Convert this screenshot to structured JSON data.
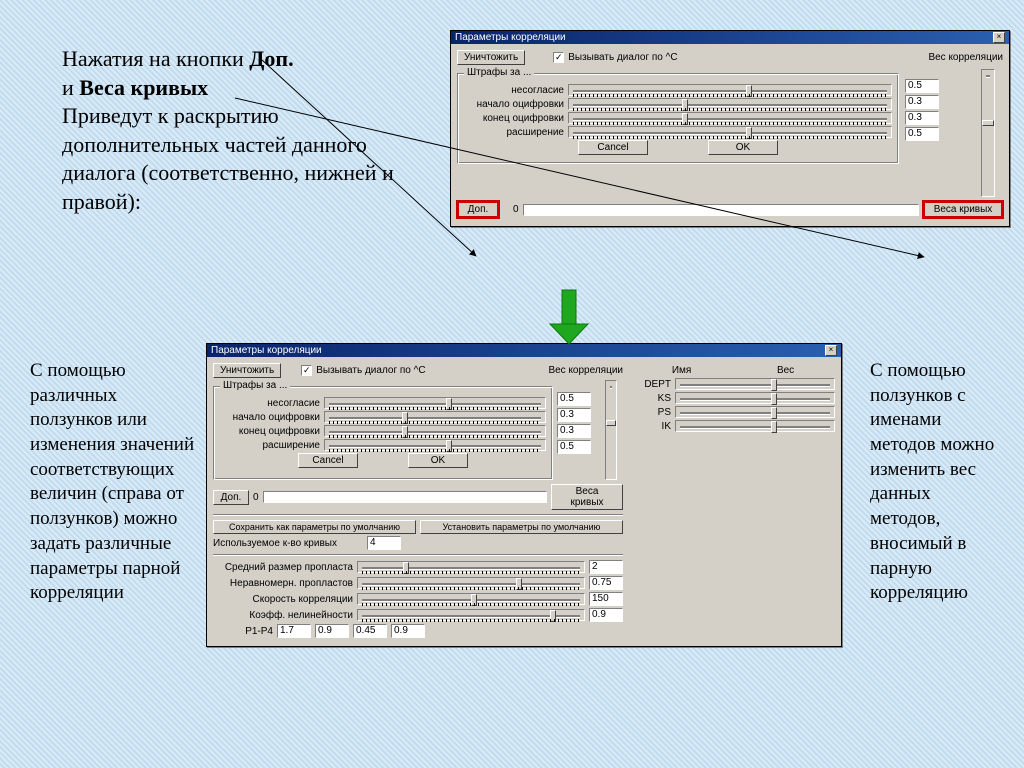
{
  "intro": {
    "l1": "Нажатия на кнопки ",
    "b1": "Доп.",
    "l2": " и ",
    "b2": "Веса кривых",
    "rest": "Приведут к раскрытию дополнительных частей данного диалога (соответственно, нижней и правой):"
  },
  "leftNote": "С помощью различных ползунков или изменения значений соответствующих величин (справа от ползунков) можно задать различные параметры парной корреляции",
  "rightNote": "С помощью ползунков с именами методов можно изменить вес данных методов, вносимый в парную корреляцию",
  "dlg": {
    "title": "Параметры корреляции",
    "destroy": "Уничтожить",
    "callDialog": "Вызывать диалог по ^C",
    "weight": "Вес корреляции",
    "penalties": "Штрафы за ...",
    "p1": "несогласие",
    "p2": "начало оцифровки",
    "p3": "конец оцифровки",
    "p4": "расширение",
    "cancel": "Cancel",
    "ok": "OK",
    "dop": "Доп.",
    "curves": "Веса кривых",
    "zero": "0",
    "v": {
      "w1": "0.5",
      "w2": "0.3",
      "w3": "0.3",
      "w4": "0.5"
    }
  },
  "dlg2": {
    "name": "Имя",
    "weightCol": "Вес",
    "methods": [
      "DEPT",
      "KS",
      "PS",
      "IK"
    ],
    "saveDefault": "Сохранить как параметры по умолчанию",
    "loadDefault": "Установить параметры по умолчанию",
    "usedCurves": "Используемое к-во кривых",
    "usedCurvesVal": "4",
    "avgLayer": "Средний размер пропласта",
    "avgLayerVal": "2",
    "uneven": "Неравномерн. пропластов",
    "unevenVal": "0.75",
    "speed": "Скорость корреляции",
    "speedVal": "150",
    "nonlin": "Коэфф. нелинейности",
    "nonlinVal": "0.9",
    "p1p4": "P1-P4",
    "p1": "1.7",
    "p2": "0.9",
    "p3": "0.45",
    "p4": "0.9"
  }
}
